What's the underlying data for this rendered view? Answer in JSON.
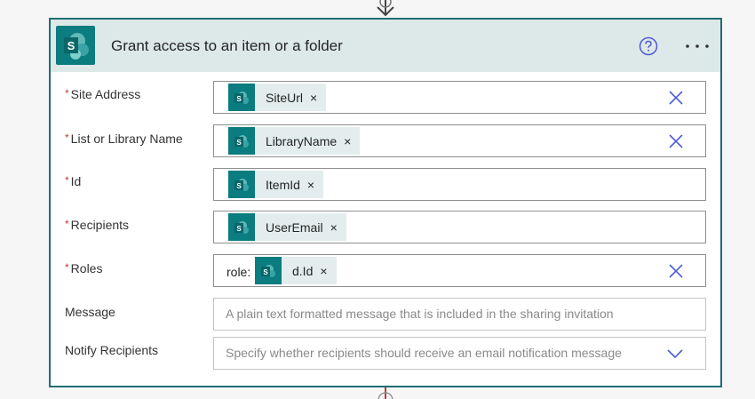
{
  "card": {
    "title": "Grant access to an item or a folder",
    "app_icon": "sharepoint-icon",
    "help_icon": "help-circle-icon",
    "more_icon": "more-horizontal-icon",
    "accent": "#0b7c7f"
  },
  "fields": {
    "site_address": {
      "label": "Site Address",
      "required": "*",
      "token": {
        "label": "SiteUrl",
        "remove": "×"
      }
    },
    "library_name": {
      "label": "List or Library Name",
      "required": "*",
      "token": {
        "label": "LibraryName",
        "remove": "×"
      }
    },
    "id": {
      "label": "Id",
      "required": "*",
      "token": {
        "label": "ItemId",
        "remove": "×"
      }
    },
    "recipients": {
      "label": "Recipients",
      "required": "*",
      "token": {
        "label": "UserEmail",
        "remove": "×"
      }
    },
    "roles": {
      "label": "Roles",
      "required": "*",
      "prefix": "role:",
      "token": {
        "label": "d.Id",
        "remove": "×"
      }
    },
    "message": {
      "label": "Message",
      "placeholder": "A plain text formatted message that is included in the sharing invitation"
    },
    "notify": {
      "label": "Notify Recipients",
      "placeholder": "Specify whether recipients should receive an email notification message"
    }
  }
}
